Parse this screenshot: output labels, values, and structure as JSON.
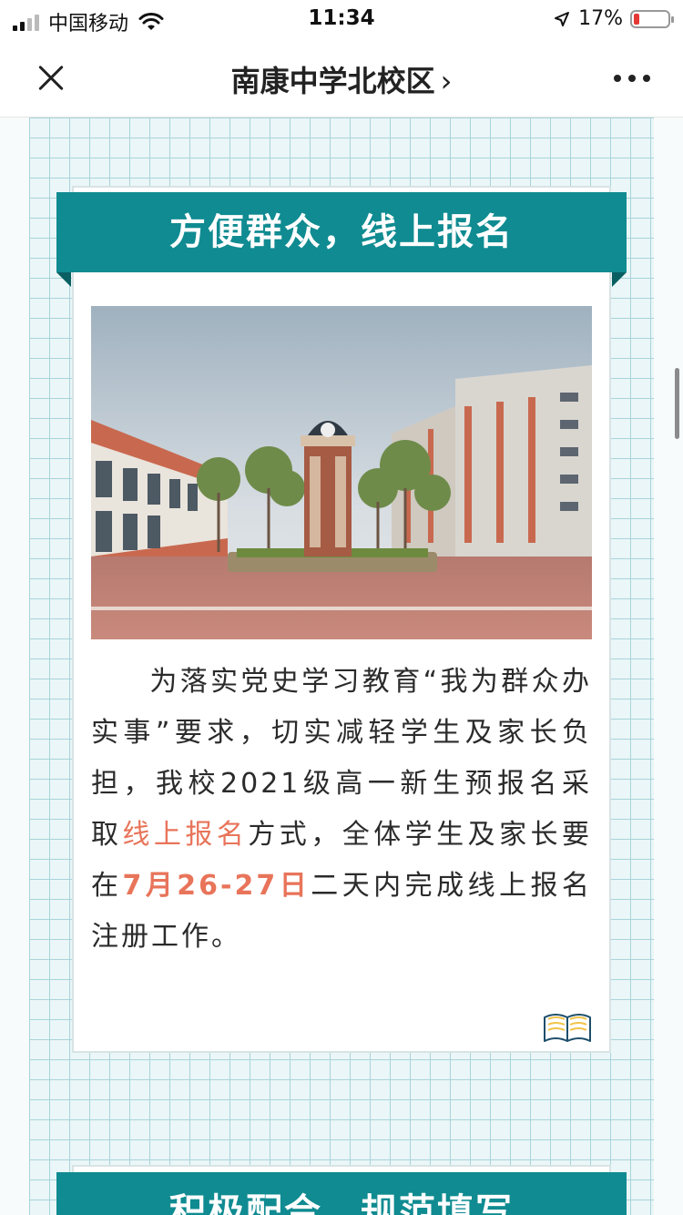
{
  "status_bar": {
    "carrier": "中国移动",
    "time": "11:34",
    "battery_percent": "17%"
  },
  "nav": {
    "title": "南康中学北校区",
    "title_chevron": "›"
  },
  "section1": {
    "heading": "方便群众，线上报名",
    "paragraph": {
      "part1": "为落实党史学习教育“我为群众办实事”要求，切实减轻学生及家长负担，我校2021级高一新生预报名采取",
      "highlight1": "线上报名",
      "part2": "方式，全体学生及家长要在",
      "highlight2": "7月26-27日",
      "part3": "二天内完成线上报名注册工作。"
    }
  },
  "section2": {
    "heading": "积极配合，规范填写"
  },
  "colors": {
    "accent": "#0f8b91",
    "highlight": "#e8745a",
    "grid": "#a9d4db"
  }
}
